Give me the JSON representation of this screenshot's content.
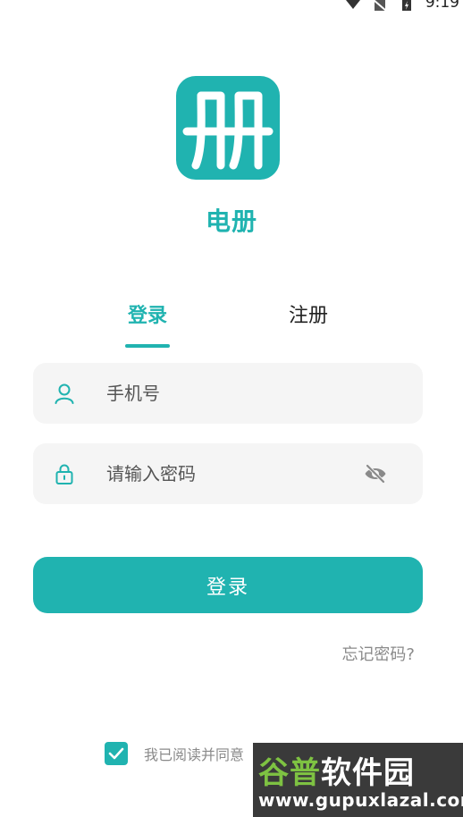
{
  "status_bar": {
    "time": "9:19",
    "icons": [
      "wifi-icon",
      "no-sim-icon",
      "battery-icon"
    ]
  },
  "app": {
    "logo_icon": "book-logo-icon",
    "name": "电册"
  },
  "tabs": [
    {
      "label": "登录",
      "active": true
    },
    {
      "label": "注册",
      "active": false
    }
  ],
  "form": {
    "phone": {
      "placeholder": "手机号",
      "value": "",
      "icon": "user-icon"
    },
    "password": {
      "placeholder": "请输入密码",
      "value": "",
      "icon": "lock-icon",
      "toggle_icon": "eye-off-icon"
    }
  },
  "login_button": {
    "label": "登录"
  },
  "forgot_password": {
    "label": "忘记密码?"
  },
  "agreement": {
    "checked": true,
    "text": "我已阅读并同意"
  },
  "watermark": {
    "title_part1": "谷普",
    "title_part2": "软件园",
    "url": "www.gupuxlazal.com"
  },
  "colors": {
    "accent": "#20b3b0",
    "field_bg": "#f5f5f5",
    "muted_text": "#8a8a8a"
  }
}
